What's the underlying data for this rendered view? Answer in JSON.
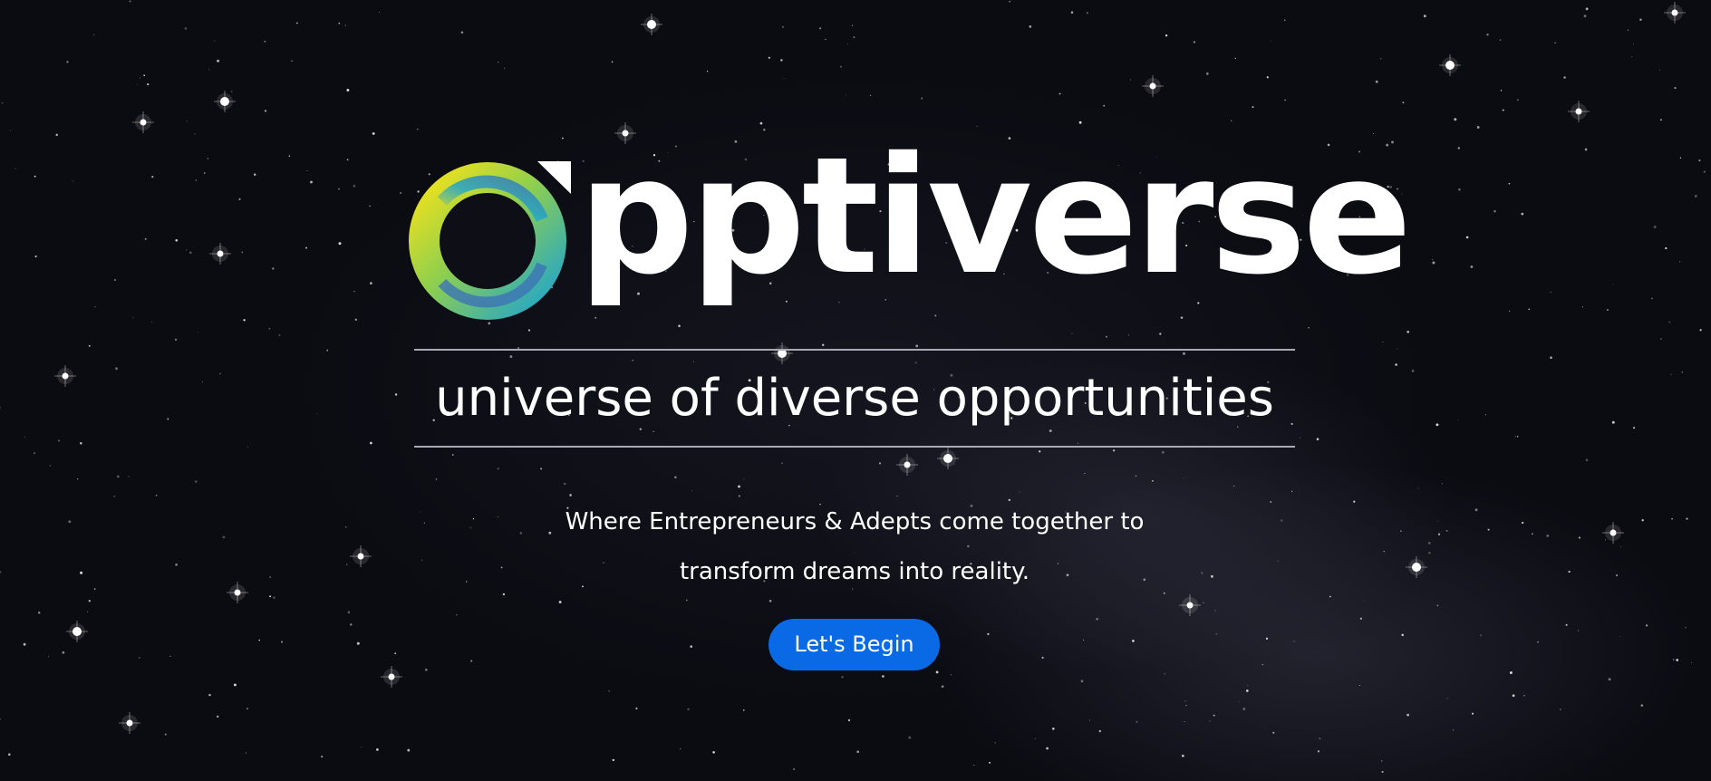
{
  "hero": {
    "brand_suffix": "pptiverse",
    "tagline": "universe of diverse opportunities",
    "description_line1": "Where Entrepreneurs & Adepts come together to",
    "description_line2": "transform dreams into reality.",
    "cta_label": "Let's Begin"
  },
  "logo": {
    "icon": "rainbow-ring-logo-icon",
    "colors": [
      "#f2e21b",
      "#23a6c9",
      "#3c73b5",
      "#8fcf4e"
    ]
  },
  "colors": {
    "background": "#0b0b12",
    "text": "#ffffff",
    "accent": "#0a6ae6",
    "rule": "#a9a9b3"
  }
}
